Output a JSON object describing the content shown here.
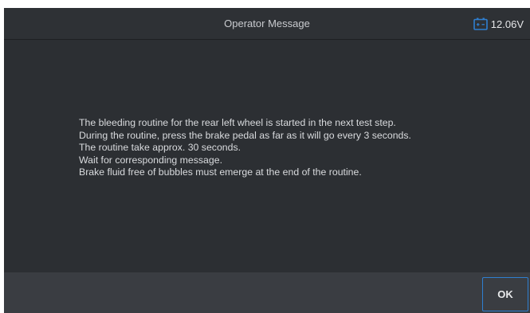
{
  "header": {
    "title": "Operator Message",
    "battery_icon": "battery-icon",
    "battery_voltage": "12.06V"
  },
  "message": {
    "lines": [
      "The bleeding routine for the rear left wheel is started in the next test step.",
      "During the routine, press the brake pedal as far as it will go every 3 seconds.",
      "The routine take approx. 30 seconds.",
      "Wait for corresponding message.",
      "Brake fluid free of bubbles must emerge at the end of the routine."
    ]
  },
  "footer": {
    "ok_label": "OK"
  },
  "colors": {
    "accent": "#2f7fd0",
    "background": "#2c2f33",
    "footer": "#3a3d42",
    "text": "#d9dbde"
  }
}
